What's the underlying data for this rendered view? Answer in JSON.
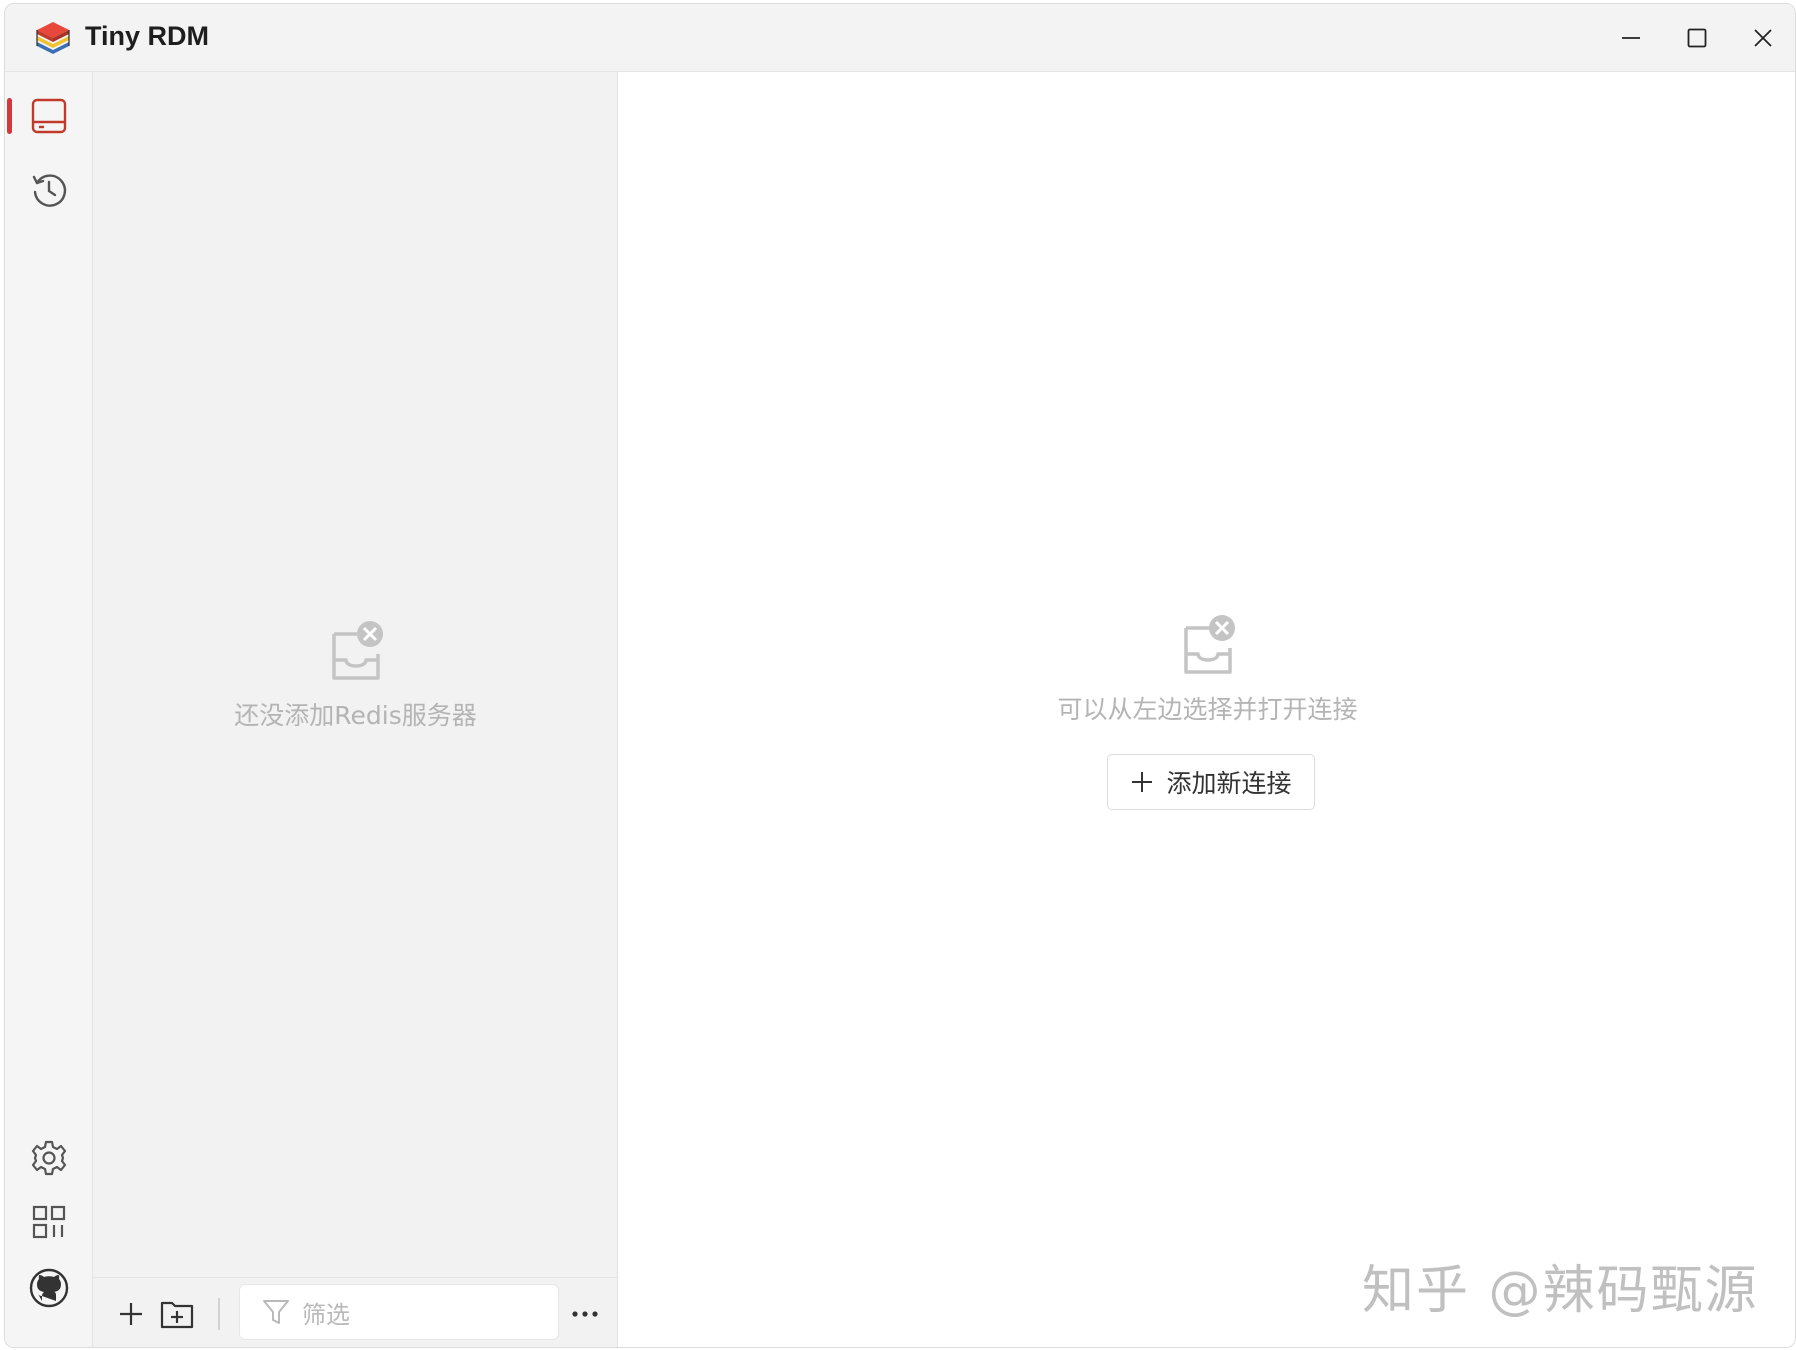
{
  "app": {
    "title": "Tiny RDM"
  },
  "titlebar": {
    "logo_icon": "tiny-rdm-logo",
    "buttons": [
      "minimize-icon",
      "maximize-icon",
      "close-icon"
    ]
  },
  "sidebar": {
    "active_color": "#d03a3a",
    "top_items": [
      {
        "name": "connections",
        "icon": "server-icon",
        "active": true
      },
      {
        "name": "history",
        "icon": "history-icon",
        "active": false
      }
    ],
    "bottom_items": [
      {
        "name": "settings",
        "icon": "gear-icon"
      },
      {
        "name": "apps",
        "icon": "apps-grid-icon"
      },
      {
        "name": "github",
        "icon": "github-icon"
      }
    ]
  },
  "connection_panel": {
    "empty_icon": "empty-inbox-icon",
    "empty_text": "还没添加Redis服务器",
    "bottom_bar": {
      "add_icon": "plus-icon",
      "add_group_icon": "folder-add-icon",
      "filter_icon": "filter-icon",
      "filter_placeholder": "筛选",
      "more_icon": "more-icon"
    }
  },
  "main": {
    "empty_icon": "empty-inbox-icon",
    "empty_text": "可以从左边选择并打开连接",
    "add_connection_label": "添加新连接",
    "add_connection_icon": "plus-icon"
  },
  "watermark": {
    "text": "知乎 @辣码甄源"
  }
}
